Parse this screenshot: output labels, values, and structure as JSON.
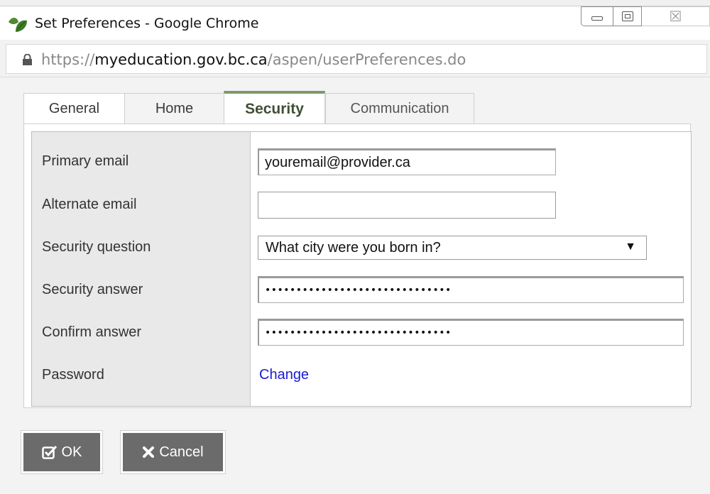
{
  "window": {
    "title": "Set Preferences - Google Chrome",
    "close_glyph": "☒"
  },
  "address_bar": {
    "scheme": "https://",
    "host": "myeducation.gov.bc.ca",
    "path": "/aspen/userPreferences.do"
  },
  "tabs": [
    {
      "label": "General"
    },
    {
      "label": "Home"
    },
    {
      "label": "Security",
      "active": true
    },
    {
      "label": "Communication"
    }
  ],
  "form": {
    "rows": [
      {
        "label": "Primary email",
        "value": "youremail@provider.ca"
      },
      {
        "label": "Alternate email",
        "value": ""
      },
      {
        "label": "Security question",
        "value": "What city were you born in?"
      },
      {
        "label": "Security answer",
        "value": "••••••••••••••••••••••••••••••"
      },
      {
        "label": "Confirm answer",
        "value": "••••••••••••••••••••••••••••••"
      },
      {
        "label": "Password",
        "value": "Change"
      }
    ]
  },
  "buttons": {
    "ok_label": "OK",
    "cancel_label": "Cancel"
  },
  "colors": {
    "active_tab_accent": "#7a9a6a",
    "link": "#1a1ad6",
    "button_bg": "#6b6b6b"
  }
}
